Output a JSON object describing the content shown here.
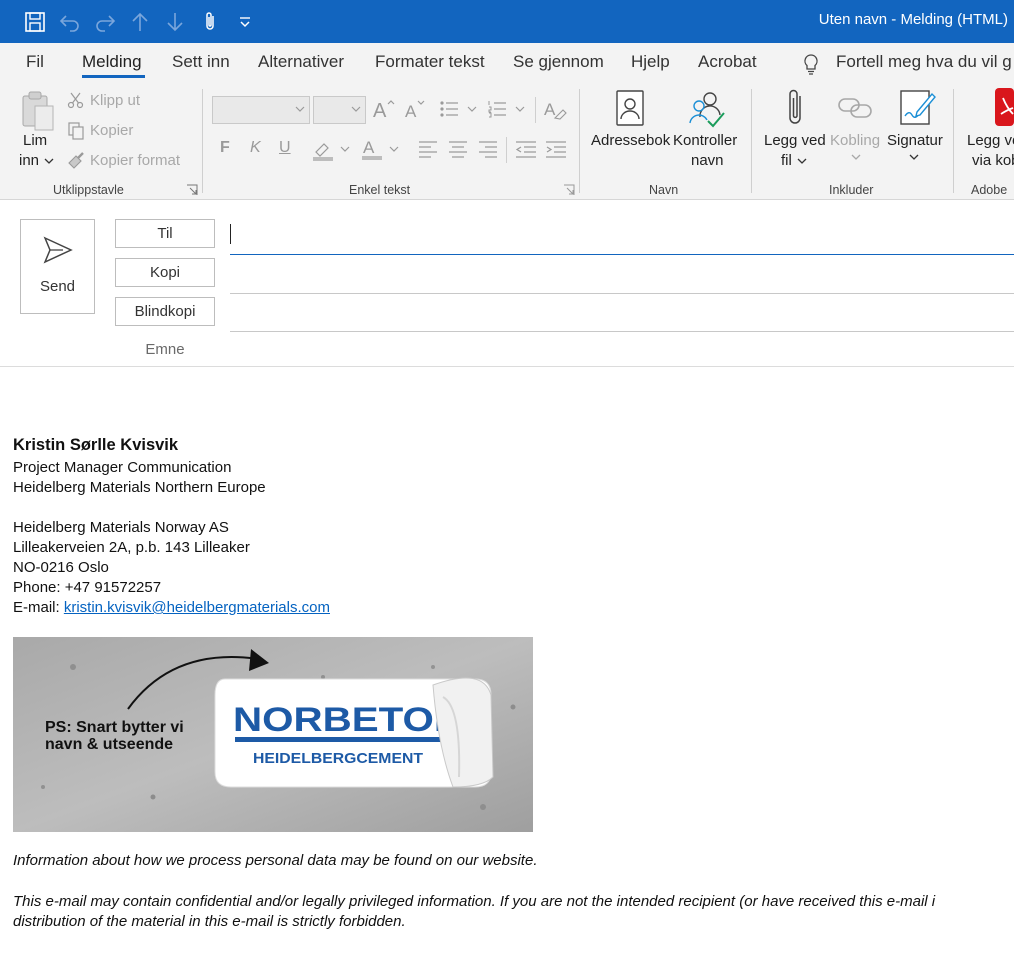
{
  "window": {
    "title": "Uten navn  -  Melding (HTML)"
  },
  "tabs": [
    {
      "label": "Fil"
    },
    {
      "label": "Melding"
    },
    {
      "label": "Sett inn"
    },
    {
      "label": "Alternativer"
    },
    {
      "label": "Formater tekst"
    },
    {
      "label": "Se gjennom"
    },
    {
      "label": "Hjelp"
    },
    {
      "label": "Acrobat"
    }
  ],
  "tell_me": {
    "text": "Fortell meg hva du vil g"
  },
  "ribbon": {
    "clipboard": {
      "paste_line1": "Lim",
      "paste_line2": "inn",
      "cut": "Klipp ut",
      "copy": "Kopier",
      "format_painter": "Kopier format",
      "group_label": "Utklippstavle"
    },
    "basic_text": {
      "bold": "F",
      "italic": "K",
      "underline": "U",
      "group_label": "Enkel tekst"
    },
    "names": {
      "address_book": "Adressebok",
      "check_names_line1": "Kontroller",
      "check_names_line2": "navn",
      "group_label": "Navn"
    },
    "include": {
      "attach_line1": "Legg ved",
      "attach_line2": "fil",
      "link": "Kobling",
      "signature": "Signatur",
      "group_label": "Inkluder"
    },
    "adobe": {
      "line1": "Legg ve",
      "line2": "via kob",
      "group_label": "Adobe"
    }
  },
  "compose": {
    "send": "Send",
    "to": "Til",
    "cc": "Kopi",
    "bcc": "Blindkopi",
    "subject": "Emne"
  },
  "signature": {
    "name": "Kristin Sørlle Kvisvik",
    "title": "Project Manager Communication",
    "org": "Heidelberg Materials Northern Europe",
    "company": "Heidelberg Materials Norway AS",
    "address": "Lilleakerveien 2A, p.b. 143 Lilleaker",
    "postal": "NO-0216 Oslo",
    "phone": "Phone: +47 91572257",
    "email_label": "E-mail: ",
    "email": "kristin.kvisvik@heidelbergmaterials.com"
  },
  "banner": {
    "ps_line1": "PS: Snart bytter vi",
    "ps_line2": "navn & utseende",
    "logo_main": "NORBETON",
    "logo_sub": "HEIDELBERGCEMENT",
    "peek1": "rg",
    "peek2": "s"
  },
  "disclaimer": {
    "privacy": "Information about how we process personal data may be found on our website.",
    "conf_line1": "This e-mail may contain confidential and/or legally privileged information. If you are not the intended recipient (or have received this e-mail i",
    "conf_line2": "distribution of the material in this e-mail is strictly forbidden."
  },
  "colors": {
    "accent": "#1265bf",
    "link": "#0563c1",
    "adobe_red": "#d9161c"
  }
}
